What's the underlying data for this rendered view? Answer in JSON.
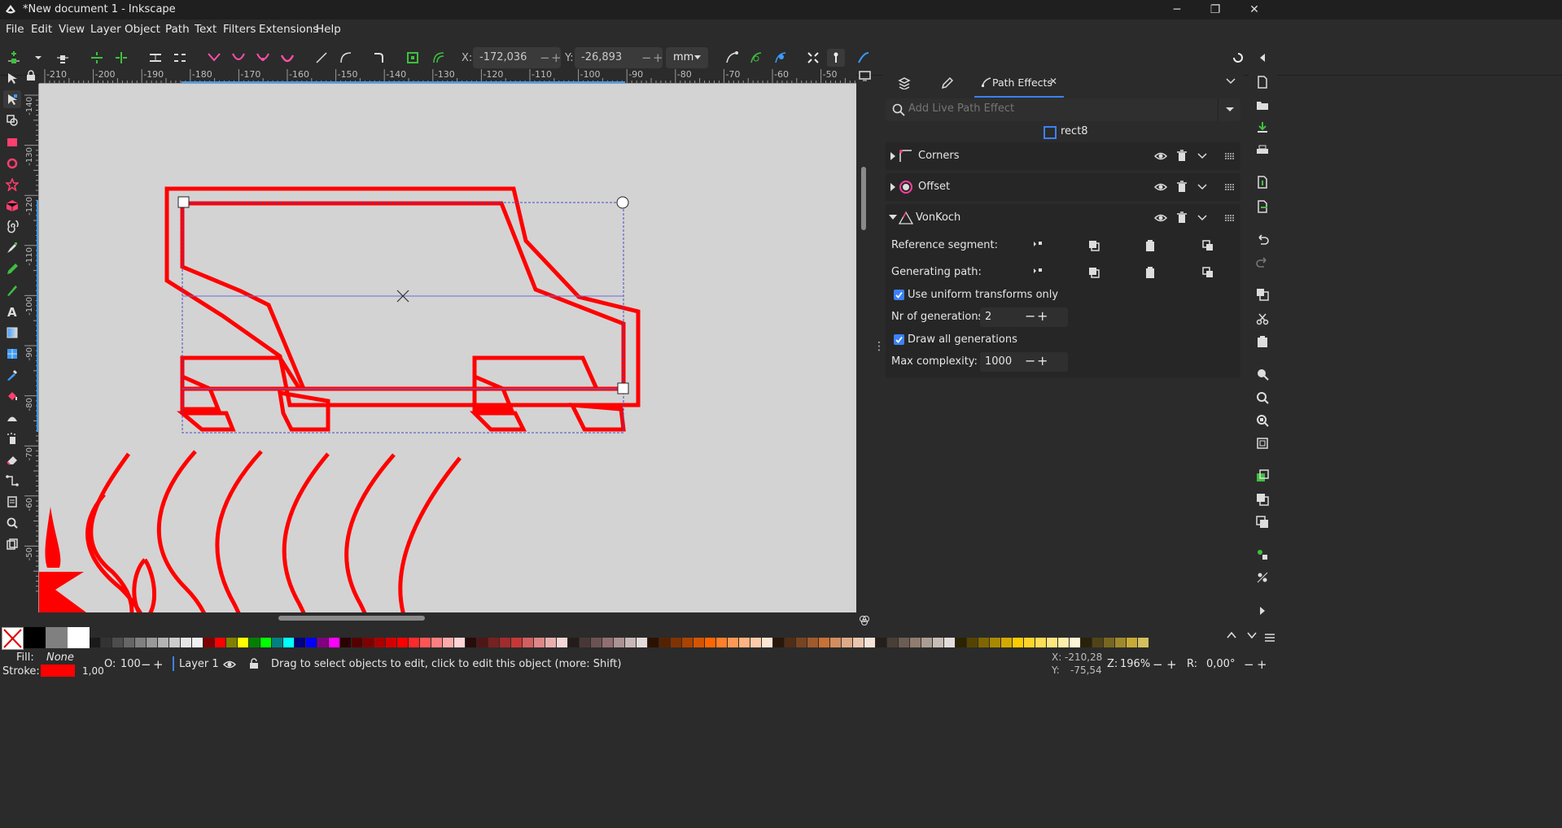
{
  "window": {
    "title": "*New document 1 - Inkscape",
    "minimize_icon": "minimize-icon",
    "maximize_icon": "restore-icon",
    "close_icon": "close-icon"
  },
  "menu": [
    "File",
    "Edit",
    "View",
    "Layer",
    "Object",
    "Path",
    "Text",
    "Filters",
    "Extensions",
    "Help"
  ],
  "toolbar": {
    "x_label": "X:",
    "x_value": "-172,036",
    "y_label": "Y:",
    "y_value": "-26,893",
    "unit": "mm"
  },
  "ruler_h": [
    "-210",
    "-200",
    "-190",
    "-180",
    "-170",
    "-160",
    "-150",
    "-140",
    "-130",
    "-120",
    "-110",
    "-100",
    "-90",
    "-80",
    "-70",
    "-60",
    "-50"
  ],
  "ruler_v": [
    "-140",
    "-130",
    "-120",
    "-110",
    "-100",
    "-90",
    "-80",
    "-70",
    "-60",
    "-50"
  ],
  "panel": {
    "tabs": [
      {
        "label": "Path Effects"
      }
    ],
    "search_placeholder": "Add Live Path Effect",
    "object_id": "rect8",
    "effects": [
      {
        "name": "Corners",
        "expanded": false
      },
      {
        "name": "Offset",
        "expanded": false
      },
      {
        "name": "VonKoch",
        "expanded": true
      }
    ],
    "params": {
      "reference_segment": "Reference segment:",
      "generating_path": "Generating path:",
      "uniform_label": "Use uniform transforms only",
      "nr_generations_label": "Nr of generations:",
      "nr_generations": "2",
      "draw_all_label": "Draw all generations",
      "max_complexity_label": "Max complexity:",
      "max_complexity": "1000"
    }
  },
  "status": {
    "fill_label": "Fill:",
    "fill_value": "None",
    "stroke_label": "Stroke:",
    "stroke_width": "1,00",
    "opacity_label": "O:",
    "opacity_value": "100",
    "layer": "Layer 1",
    "message": "Drag to select objects to edit, click to edit this object (more: Shift)",
    "cursor_x_label": "X:",
    "cursor_x": "-210,28",
    "cursor_y_label": "Y:",
    "cursor_y": "-75,54",
    "zoom_label": "Z:",
    "zoom": "196%",
    "rotate_label": "R:",
    "rotate": "0,00°"
  },
  "colors": {
    "accent": "#3b82f6",
    "stroke_red": "#ff0000",
    "canvas": "#d3d3d3",
    "ui_bg": "#2b2b2b"
  },
  "palette_swatches": [
    "#000000",
    "#808080",
    "#ffffff",
    "#1a1a1a",
    "#333333",
    "#4d4d4d",
    "#666666",
    "#808080",
    "#999999",
    "#b3b3b3",
    "#cccccc",
    "#e6e6e6",
    "#f2f2f2",
    "#800000",
    "#ff0000",
    "#808000",
    "#ffff00",
    "#008000",
    "#00ff00",
    "#008080",
    "#00ffff",
    "#000080",
    "#0000ff",
    "#800080",
    "#ff00ff",
    "#2b0000",
    "#550000",
    "#800000",
    "#aa0000",
    "#d40000",
    "#ff0000",
    "#ff2a2a",
    "#ff5555",
    "#ff8080",
    "#ffaaaa",
    "#ffd5d5",
    "#280b0b",
    "#501616",
    "#782121",
    "#a02c2c",
    "#c83737",
    "#d35f5f",
    "#de8787",
    "#e9afaf",
    "#f4d7d7",
    "#241c1c",
    "#483737",
    "#6c5353",
    "#916f6f",
    "#ac9393",
    "#c8b7b7",
    "#e3dbdb",
    "#2b1100",
    "#552200",
    "#803300",
    "#aa4400",
    "#d45500",
    "#ff6600",
    "#ff7f2a",
    "#ff9955",
    "#ffb380",
    "#ffccaa",
    "#ffe6d5",
    "#28170b",
    "#502d16",
    "#784421",
    "#a05a2c",
    "#c87137",
    "#d38d5f",
    "#deaa87",
    "#e9c6af",
    "#f4e3d7",
    "#241f1c",
    "#483e37",
    "#6c5d53",
    "#917c6f",
    "#ac9d93",
    "#c8beb7",
    "#e3dedb",
    "#2b2200",
    "#554400",
    "#806600",
    "#aa8800",
    "#d4aa00",
    "#ffcc00",
    "#ffd42a",
    "#ffdd55",
    "#ffe680",
    "#ffeeaa",
    "#fff6d5",
    "#28220b",
    "#504416",
    "#786721",
    "#a0892c",
    "#c8ab37",
    "#d4bf5f"
  ]
}
